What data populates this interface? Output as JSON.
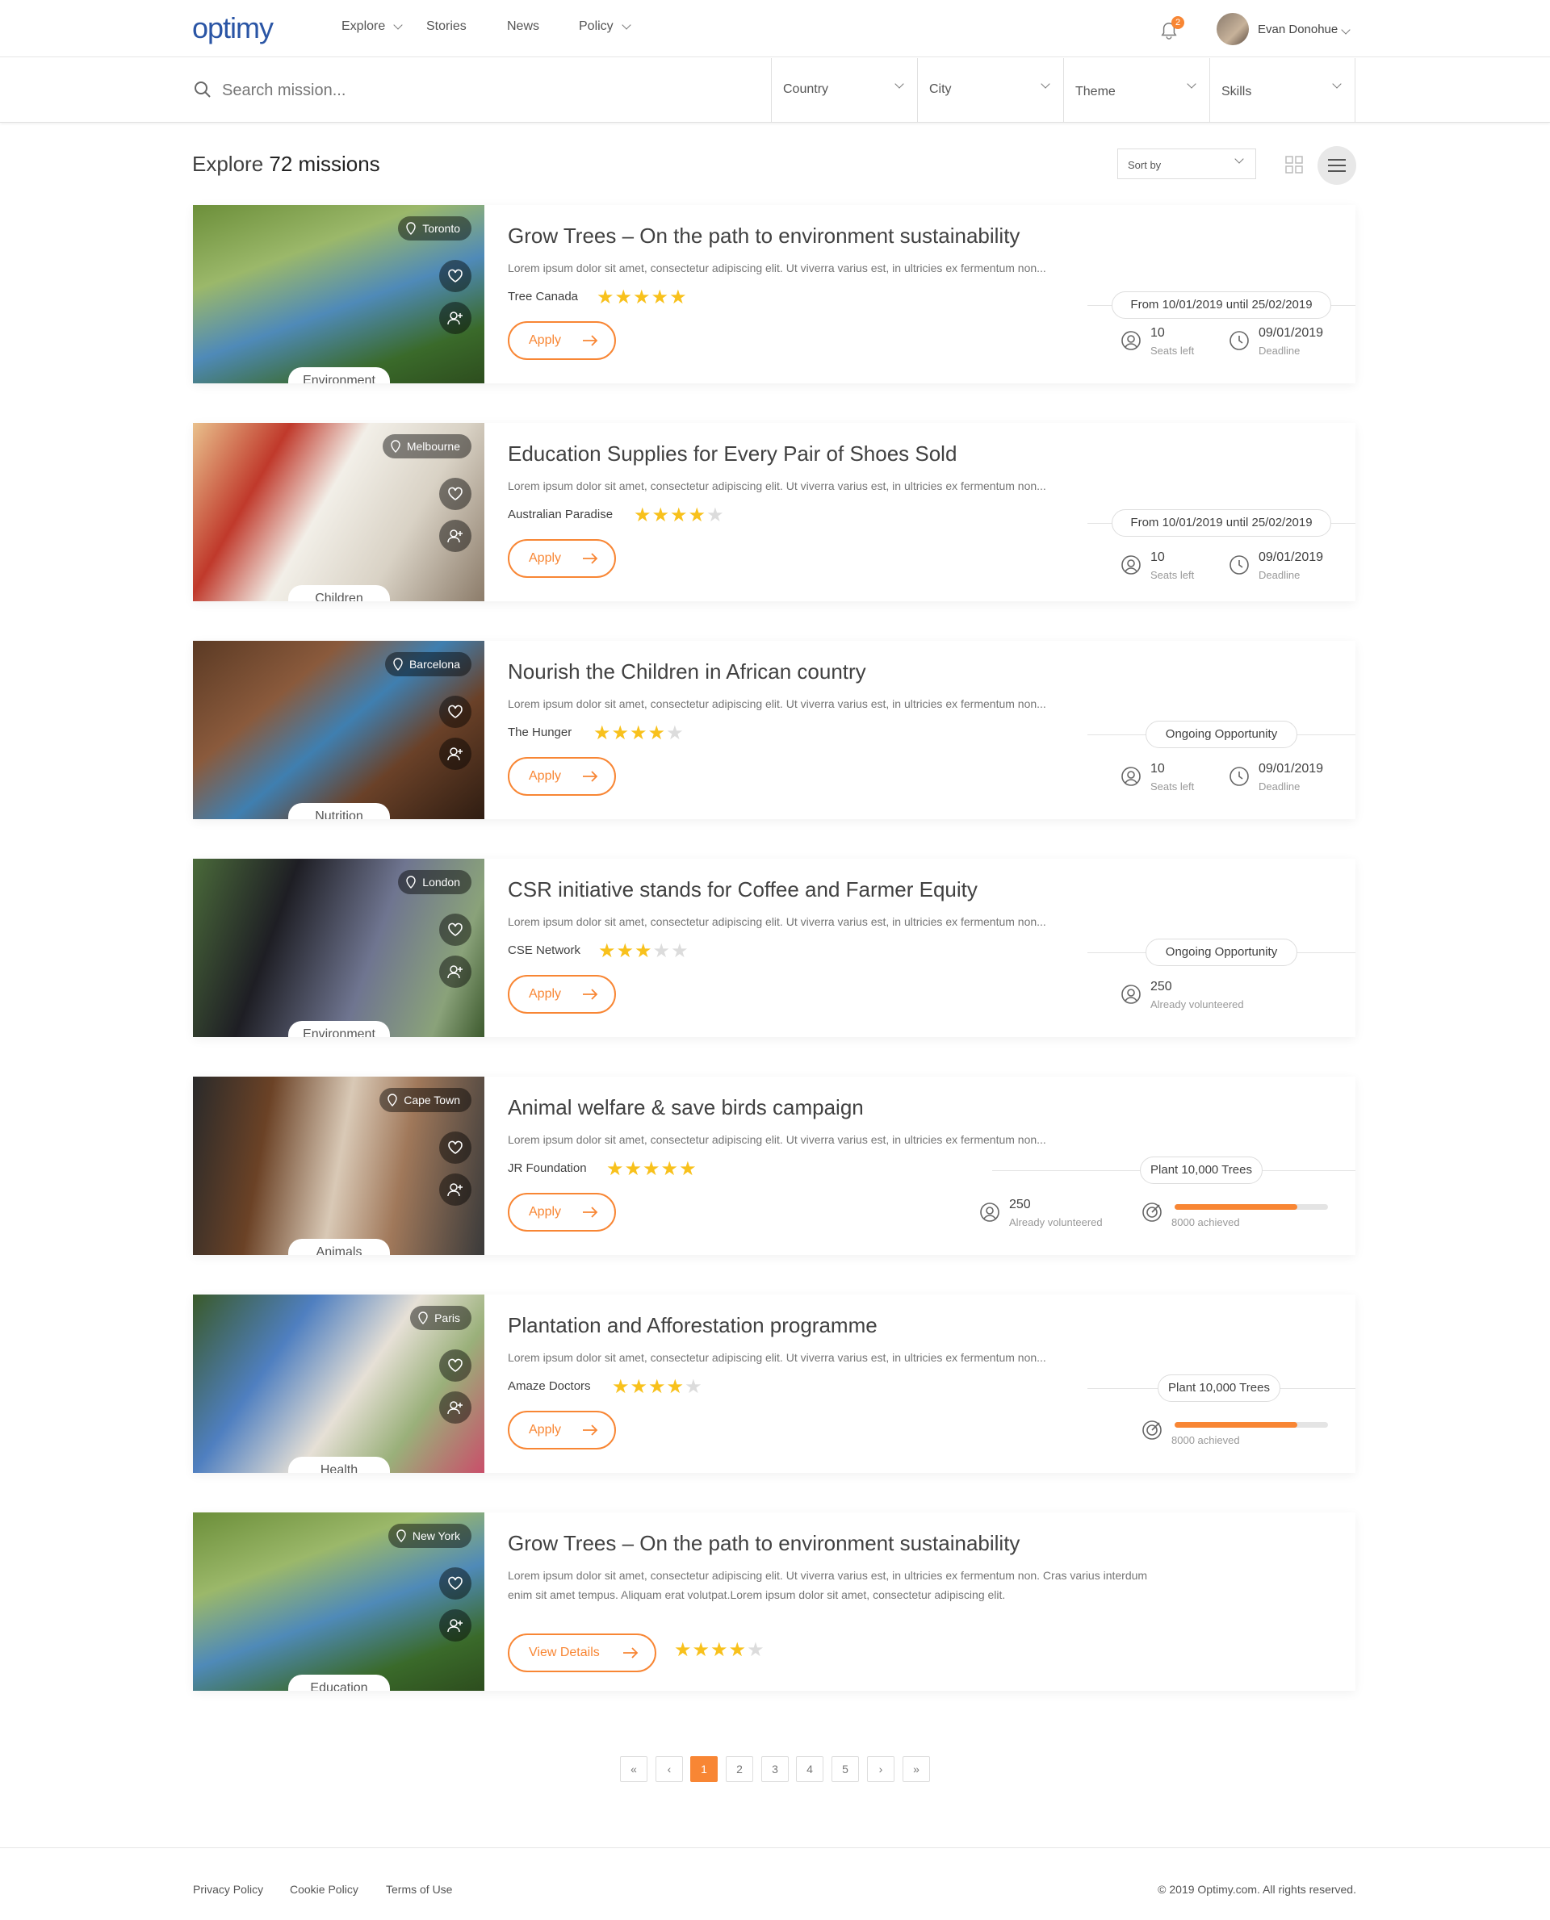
{
  "header": {
    "logo": "optimy",
    "nav": [
      "Explore",
      "Stories",
      "News",
      "Policy"
    ],
    "notification_count": "2",
    "user_name": "Evan Donohue"
  },
  "search": {
    "placeholder": "Search mission...",
    "filters": [
      "Country",
      "City",
      "Theme",
      "Skills"
    ]
  },
  "explore": {
    "prefix": "Explore",
    "count_text": "72 missions",
    "sort_label": "Sort by"
  },
  "colors": {
    "accent": "#f88634",
    "star": "#f8c11c",
    "brand": "#2a55a5"
  },
  "missions": [
    {
      "location": "Toronto",
      "theme": "Environment",
      "title": "Grow Trees – On the path to environment sustainability",
      "description": "Lorem ipsum dolor sit amet, consectetur adipiscing elit. Ut viverra varius est, in ultricies ex fermentum non...",
      "org": "Tree Canada",
      "rating": 5,
      "button": "Apply",
      "pill": "From 10/01/2019 until 25/02/2019",
      "stat1_value": "10",
      "stat1_label": "Seats left",
      "stat2_value": "09/01/2019",
      "stat2_label": "Deadline"
    },
    {
      "location": "Melbourne",
      "theme": "Children",
      "title": "Education Supplies for Every Pair of Shoes Sold",
      "description": "Lorem ipsum dolor sit amet, consectetur adipiscing elit. Ut viverra varius est, in ultricies ex fermentum non...",
      "org": "Australian Paradise",
      "rating": 4,
      "button": "Apply",
      "pill": "From 10/01/2019 until 25/02/2019",
      "stat1_value": "10",
      "stat1_label": "Seats left",
      "stat2_value": "09/01/2019",
      "stat2_label": "Deadline"
    },
    {
      "location": "Barcelona",
      "theme": "Nutrition",
      "title": "Nourish the Children in African country",
      "description": "Lorem ipsum dolor sit amet, consectetur adipiscing elit. Ut viverra varius est, in ultricies ex fermentum non...",
      "org": "The Hunger",
      "rating": 4,
      "button": "Apply",
      "pill": "Ongoing Opportunity",
      "stat1_value": "10",
      "stat1_label": "Seats left",
      "stat2_value": "09/01/2019",
      "stat2_label": "Deadline"
    },
    {
      "location": "London",
      "theme": "Environment",
      "title": "CSR initiative stands for Coffee and Farmer Equity",
      "description": "Lorem ipsum dolor sit amet, consectetur adipiscing elit. Ut viverra varius est, in ultricies ex fermentum non...",
      "org": "CSE Network",
      "rating": 3,
      "button": "Apply",
      "pill": "Ongoing Opportunity",
      "stat1_value": "250",
      "stat1_label": "Already volunteered"
    },
    {
      "location": "Cape Town",
      "theme": "Animals",
      "title": "Animal welfare & save birds campaign",
      "description": "Lorem ipsum dolor sit amet, consectetur adipiscing elit. Ut viverra varius est, in ultricies ex fermentum non...",
      "org": "JR Foundation",
      "rating": 5,
      "button": "Apply",
      "pill": "Plant 10,000 Trees",
      "stat1_value": "250",
      "stat1_label": "Already volunteered",
      "goal_label": "8000 achieved",
      "goal_progress": 0.8
    },
    {
      "location": "Paris",
      "theme": "Health",
      "title": "Plantation and Afforestation programme",
      "description": "Lorem ipsum dolor sit amet, consectetur adipiscing elit. Ut viverra varius est, in ultricies ex fermentum non...",
      "org": "Amaze Doctors",
      "rating": 4,
      "button": "Apply",
      "pill": "Plant 10,000 Trees",
      "goal_label": "8000 achieved",
      "goal_progress": 0.8
    },
    {
      "location": "New York",
      "theme": "Education",
      "title": "Grow Trees – On the path to environment sustainability",
      "description_line1": "Lorem ipsum dolor sit amet, consectetur adipiscing elit. Ut viverra varius est, in ultricies ex fermentum  non. Cras varius interdum",
      "description_line2": "enim sit amet tempus. Aliquam erat volutpat.Lorem ipsum dolor sit amet, consectetur adipiscing elit.",
      "rating": 4,
      "button": "View Details"
    }
  ],
  "pagination": {
    "first": "«",
    "prev": "‹",
    "pages": [
      "1",
      "2",
      "3",
      "4",
      "5"
    ],
    "current": "1",
    "next": "›",
    "last": "»"
  },
  "footer": {
    "links": [
      "Privacy Policy",
      "Cookie Policy",
      "Terms of Use"
    ],
    "copyright": "© 2019 Optimy.com. All rights reserved."
  }
}
